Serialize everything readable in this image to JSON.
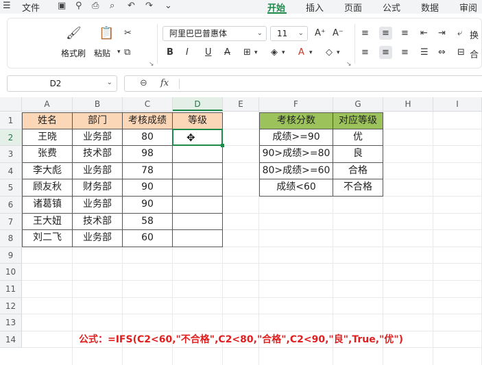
{
  "menubar": {
    "file_label": "文件",
    "tabs": [
      "开始",
      "插入",
      "页面",
      "公式",
      "数据",
      "审阅"
    ],
    "active_tab": "开始"
  },
  "ribbon": {
    "format_painter": "格式刷",
    "paste": "粘贴",
    "font_name": "阿里巴巴普惠体",
    "font_size": "11",
    "bold": "B",
    "italic": "I",
    "underline": "U",
    "wrap": "换",
    "merge": "合"
  },
  "formula_bar": {
    "name_box": "D2",
    "fx": "fx",
    "content": ""
  },
  "columns": [
    "A",
    "B",
    "C",
    "D",
    "E",
    "F",
    "G",
    "H",
    "I"
  ],
  "rows": [
    "1",
    "2",
    "3",
    "4",
    "5",
    "6",
    "7",
    "8",
    "9",
    "10",
    "11",
    "12",
    "13",
    "14"
  ],
  "table_main": {
    "headers": [
      "姓名",
      "部门",
      "考核成绩",
      "等级"
    ],
    "rows": [
      [
        "王晓",
        "业务部",
        "80",
        ""
      ],
      [
        "张费",
        "技术部",
        "98",
        ""
      ],
      [
        "李大彪",
        "业务部",
        "78",
        ""
      ],
      [
        "顾友秋",
        "财务部",
        "90",
        ""
      ],
      [
        "诸葛镇",
        "业务部",
        "90",
        ""
      ],
      [
        "王大妞",
        "技术部",
        "58",
        ""
      ],
      [
        "刘二飞",
        "业务部",
        "60",
        ""
      ]
    ]
  },
  "table_lookup": {
    "headers": [
      "考核分数",
      "对应等级"
    ],
    "rows": [
      [
        "成绩>=90",
        "优"
      ],
      [
        "90>成绩>=80",
        "良"
      ],
      [
        "80>成绩>=60",
        "合格"
      ],
      [
        "成绩<60",
        "不合格"
      ]
    ]
  },
  "selected_cell": "D2",
  "formula_note": "公式：=IFS(C2<60,\"不合格\",C2<80,\"合格\",C2<90,\"良\",True,\"优\")",
  "colors": {
    "accent": "#1e8a4a",
    "peach_header": "#fbd7b8",
    "green_header": "#9cc35b",
    "note_red": "#e02020"
  }
}
